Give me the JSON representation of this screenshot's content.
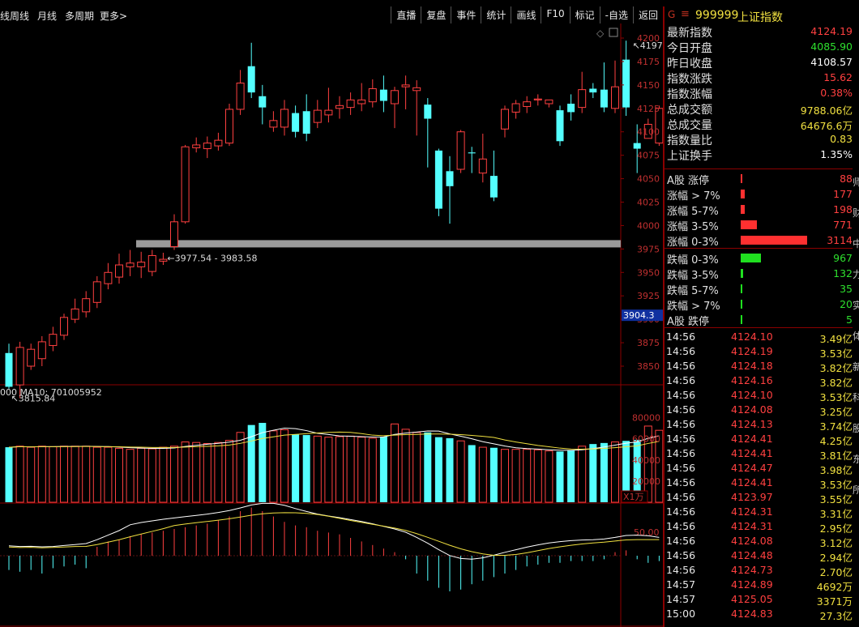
{
  "toolbar": {
    "periods": [
      "线",
      "周线",
      "月线",
      "多周期",
      "更多>"
    ],
    "tools": [
      "直播",
      "复盘",
      "事件",
      "统计",
      "画线",
      "F10",
      "标记",
      "-自选",
      "返回"
    ]
  },
  "icons": {
    "menu": "menu-icon",
    "chart_settings": "diamond-icon",
    "maximize": "square-icon"
  },
  "colors": {
    "up": "#ff4040",
    "down": "#54ffff",
    "ma5": "#ffffff",
    "ma10": "#f0e040",
    "accent": "#8b0000"
  },
  "chart_data": {
    "type": "candlestick",
    "price_axis": {
      "ticks": [
        4200,
        4175,
        4150,
        4125,
        4100,
        4075,
        4050,
        4025,
        4000,
        3975,
        3950,
        3925,
        3900,
        3875,
        3850
      ],
      "ylim": [
        3800,
        4210
      ]
    },
    "candles": [
      [
        3864,
        3828,
        3874,
        3826
      ],
      [
        3830,
        3870,
        3876,
        3815.84
      ],
      [
        3850,
        3868,
        3874,
        3846
      ],
      [
        3858,
        3876,
        3882,
        3850
      ],
      [
        3872,
        3884,
        3892,
        3866
      ],
      [
        3883,
        3902,
        3906,
        3878
      ],
      [
        3900,
        3911,
        3922,
        3896
      ],
      [
        3908,
        3922,
        3930,
        3902
      ],
      [
        3918,
        3940,
        3946,
        3912
      ],
      [
        3938,
        3950,
        3960,
        3932
      ],
      [
        3945,
        3958,
        3970,
        3938
      ],
      [
        3956,
        3960,
        3974,
        3946
      ],
      [
        3956,
        3961,
        3972,
        3944
      ],
      [
        3951,
        3968,
        3974,
        3946
      ],
      [
        3962,
        3964,
        3971,
        3958
      ],
      [
        3977.54,
        4004,
        4012,
        3974
      ],
      [
        4004,
        4084,
        4086,
        4002
      ],
      [
        4083,
        4086,
        4094,
        4078
      ],
      [
        4082,
        4088,
        4095,
        4072
      ],
      [
        4085,
        4091,
        4099,
        4080
      ],
      [
        4088,
        4124,
        4130,
        4085
      ],
      [
        4124,
        4152,
        4166,
        4118
      ],
      [
        4170,
        4142,
        4195,
        4136
      ],
      [
        4138,
        4126,
        4150,
        4108
      ],
      [
        4105,
        4112,
        4122,
        4100
      ],
      [
        4105,
        4124,
        4134,
        4096
      ],
      [
        4120,
        4100,
        4128,
        4094
      ],
      [
        4122,
        4098,
        4140,
        4090
      ],
      [
        4110,
        4123,
        4134,
        4104
      ],
      [
        4118,
        4123,
        4147,
        4110
      ],
      [
        4125,
        4128,
        4138,
        4114
      ],
      [
        4126,
        4134,
        4142,
        4118
      ],
      [
        4130,
        4134,
        4152,
        4122
      ],
      [
        4132,
        4146,
        4156,
        4126
      ],
      [
        4145,
        4133,
        4160,
        4121
      ],
      [
        4130,
        4144,
        4148,
        4104
      ],
      [
        4148,
        4150,
        4160,
        4124
      ],
      [
        4144,
        4147,
        4155,
        4096
      ],
      [
        4129,
        4114,
        4136,
        4062
      ],
      [
        4080,
        4018,
        4082,
        4010
      ],
      [
        4058,
        4042,
        4074,
        4002
      ],
      [
        4060,
        4100,
        4102,
        4056
      ],
      [
        4078,
        4077,
        4084,
        4056
      ],
      [
        4056,
        4071,
        4098,
        4046
      ],
      [
        4053,
        4030,
        4080,
        4026
      ],
      [
        4103,
        4124,
        4128,
        4094
      ],
      [
        4121,
        4130,
        4134,
        4114
      ],
      [
        4127,
        4132,
        4138,
        4120
      ],
      [
        4134,
        4135,
        4140,
        4128
      ],
      [
        4130,
        4134,
        4134,
        4126
      ],
      [
        4123,
        4090,
        4128,
        4085
      ],
      [
        4130,
        4121,
        4140,
        4112
      ],
      [
        4126,
        4145,
        4164,
        4120
      ],
      [
        4146,
        4142,
        4152,
        4136
      ],
      [
        4145,
        4126,
        4174,
        4121
      ],
      [
        4125,
        4148,
        4176,
        4120
      ],
      [
        4177,
        4126,
        4197.23,
        4117
      ],
      [
        4088,
        4082,
        4108,
        4056
      ],
      [
        4093,
        4108,
        4114,
        4098
      ],
      [
        4088,
        4125,
        4128,
        4085
      ]
    ],
    "annotations": {
      "high": "4197.23",
      "low": "3815.84",
      "gap": "3977.54 - 3983.58",
      "cursor_price": "3904.3"
    },
    "gap_range": [
      3977.54,
      3983.58
    ],
    "volume": {
      "label": "000 MA10: 701005952",
      "ticks": [
        80000,
        60000,
        40000,
        20000
      ],
      "unit": "X1万",
      "values": [
        52000,
        53000,
        52000,
        53000,
        52500,
        53000,
        53000,
        53000,
        52000,
        52000,
        51000,
        50000,
        51000,
        50500,
        52000,
        53000,
        57000,
        56500,
        55500,
        56500,
        58500,
        66000,
        73000,
        75000,
        67500,
        68500,
        64000,
        63500,
        62500,
        61500,
        62000,
        62500,
        61500,
        60500,
        62000,
        74000,
        69000,
        66000,
        66000,
        61500,
        60500,
        58000,
        54000,
        52000,
        51500,
        50000,
        50000,
        50000,
        49500,
        48500,
        48000,
        49000,
        53000,
        55000,
        56000,
        57000,
        58000,
        59000,
        72000,
        68000,
        62000
      ]
    },
    "indicator": {
      "label": "50.00",
      "values": [
        -8,
        -9,
        -8,
        -10,
        -7,
        -6,
        -5,
        -7,
        5,
        8,
        9,
        11,
        12,
        13,
        14,
        15,
        16,
        17,
        18,
        20,
        22,
        25,
        27,
        25,
        22,
        19,
        17,
        16,
        14,
        13,
        12,
        10,
        8,
        6,
        4,
        2,
        -2,
        -10,
        -14,
        -18,
        -20,
        -19,
        -16,
        -14,
        -12,
        -10,
        -8,
        -6,
        -5,
        -4,
        -4,
        -3,
        -3,
        -3,
        -2,
        2,
        3,
        -2,
        -4,
        -3
      ]
    }
  },
  "sidebar": {
    "marker": "G",
    "code": "999999",
    "name": "上证指数",
    "quote": [
      {
        "label": "最新指数",
        "value": "4124.19",
        "color": "#ff4040"
      },
      {
        "label": "今日开盘",
        "value": "4085.90",
        "color": "#2ee02e"
      },
      {
        "label": "昨日收盘",
        "value": "4108.57",
        "color": "#ffffff"
      },
      {
        "label": "指数涨跌",
        "value": "15.62",
        "color": "#ff4040"
      },
      {
        "label": "指数涨幅",
        "value": "0.38%",
        "color": "#ff4040"
      },
      {
        "label": "总成交额",
        "value": "9788.06亿",
        "color": "#f0e040"
      },
      {
        "label": "总成交量",
        "value": "64676.6万",
        "color": "#f0e040"
      },
      {
        "label": "指数量比",
        "value": "0.83",
        "color": "#f0e040"
      },
      {
        "label": "上证换手",
        "value": "1.35%",
        "color": "#ffffff"
      }
    ],
    "breadth": [
      {
        "label": "A股 涨停",
        "value": "88",
        "count": 88,
        "kind": "up"
      },
      {
        "label": "涨幅 > 7%",
        "value": "177",
        "count": 177,
        "kind": "up"
      },
      {
        "label": "涨幅 5-7%",
        "value": "198",
        "count": 198,
        "kind": "up"
      },
      {
        "label": "涨幅 3-5%",
        "value": "771",
        "count": 771,
        "kind": "up"
      },
      {
        "label": "涨幅 0-3%",
        "value": "3114",
        "count": 3114,
        "kind": "up"
      },
      {
        "label": "跌幅 0-3%",
        "value": "967",
        "count": 967,
        "kind": "down"
      },
      {
        "label": "跌幅 3-5%",
        "value": "132",
        "count": 132,
        "kind": "down"
      },
      {
        "label": "跌幅 5-7%",
        "value": "35",
        "count": 35,
        "kind": "down"
      },
      {
        "label": "跌幅 > 7%",
        "value": "20",
        "count": 20,
        "kind": "down"
      },
      {
        "label": "A股 跌停",
        "value": "5",
        "count": 5,
        "kind": "down"
      }
    ],
    "ticks": [
      {
        "t": "14:56",
        "p": "4124.10",
        "q": "3.49亿"
      },
      {
        "t": "14:56",
        "p": "4124.19",
        "q": "3.53亿"
      },
      {
        "t": "14:56",
        "p": "4124.18",
        "q": "3.82亿"
      },
      {
        "t": "14:56",
        "p": "4124.16",
        "q": "3.82亿"
      },
      {
        "t": "14:56",
        "p": "4124.10",
        "q": "3.53亿"
      },
      {
        "t": "14:56",
        "p": "4124.08",
        "q": "3.25亿"
      },
      {
        "t": "14:56",
        "p": "4124.13",
        "q": "3.74亿"
      },
      {
        "t": "14:56",
        "p": "4124.41",
        "q": "4.25亿"
      },
      {
        "t": "14:56",
        "p": "4124.41",
        "q": "3.81亿"
      },
      {
        "t": "14:56",
        "p": "4124.47",
        "q": "3.98亿"
      },
      {
        "t": "14:56",
        "p": "4124.41",
        "q": "3.53亿"
      },
      {
        "t": "14:56",
        "p": "4123.97",
        "q": "3.55亿"
      },
      {
        "t": "14:56",
        "p": "4124.31",
        "q": "3.31亿"
      },
      {
        "t": "14:56",
        "p": "4124.31",
        "q": "2.95亿"
      },
      {
        "t": "14:56",
        "p": "4124.08",
        "q": "3.12亿"
      },
      {
        "t": "14:56",
        "p": "4124.48",
        "q": "2.94亿"
      },
      {
        "t": "14:56",
        "p": "4124.73",
        "q": "2.70亿"
      },
      {
        "t": "14:57",
        "p": "4124.89",
        "q": "4692万"
      },
      {
        "t": "14:57",
        "p": "4125.05",
        "q": "3371万"
      },
      {
        "t": "15:00",
        "p": "4124.83",
        "q": "27.3亿"
      }
    ],
    "edge_chars": [
      "师",
      "财",
      "中",
      "力",
      "实",
      "体",
      "新",
      "科",
      "股",
      "东",
      "所"
    ]
  }
}
